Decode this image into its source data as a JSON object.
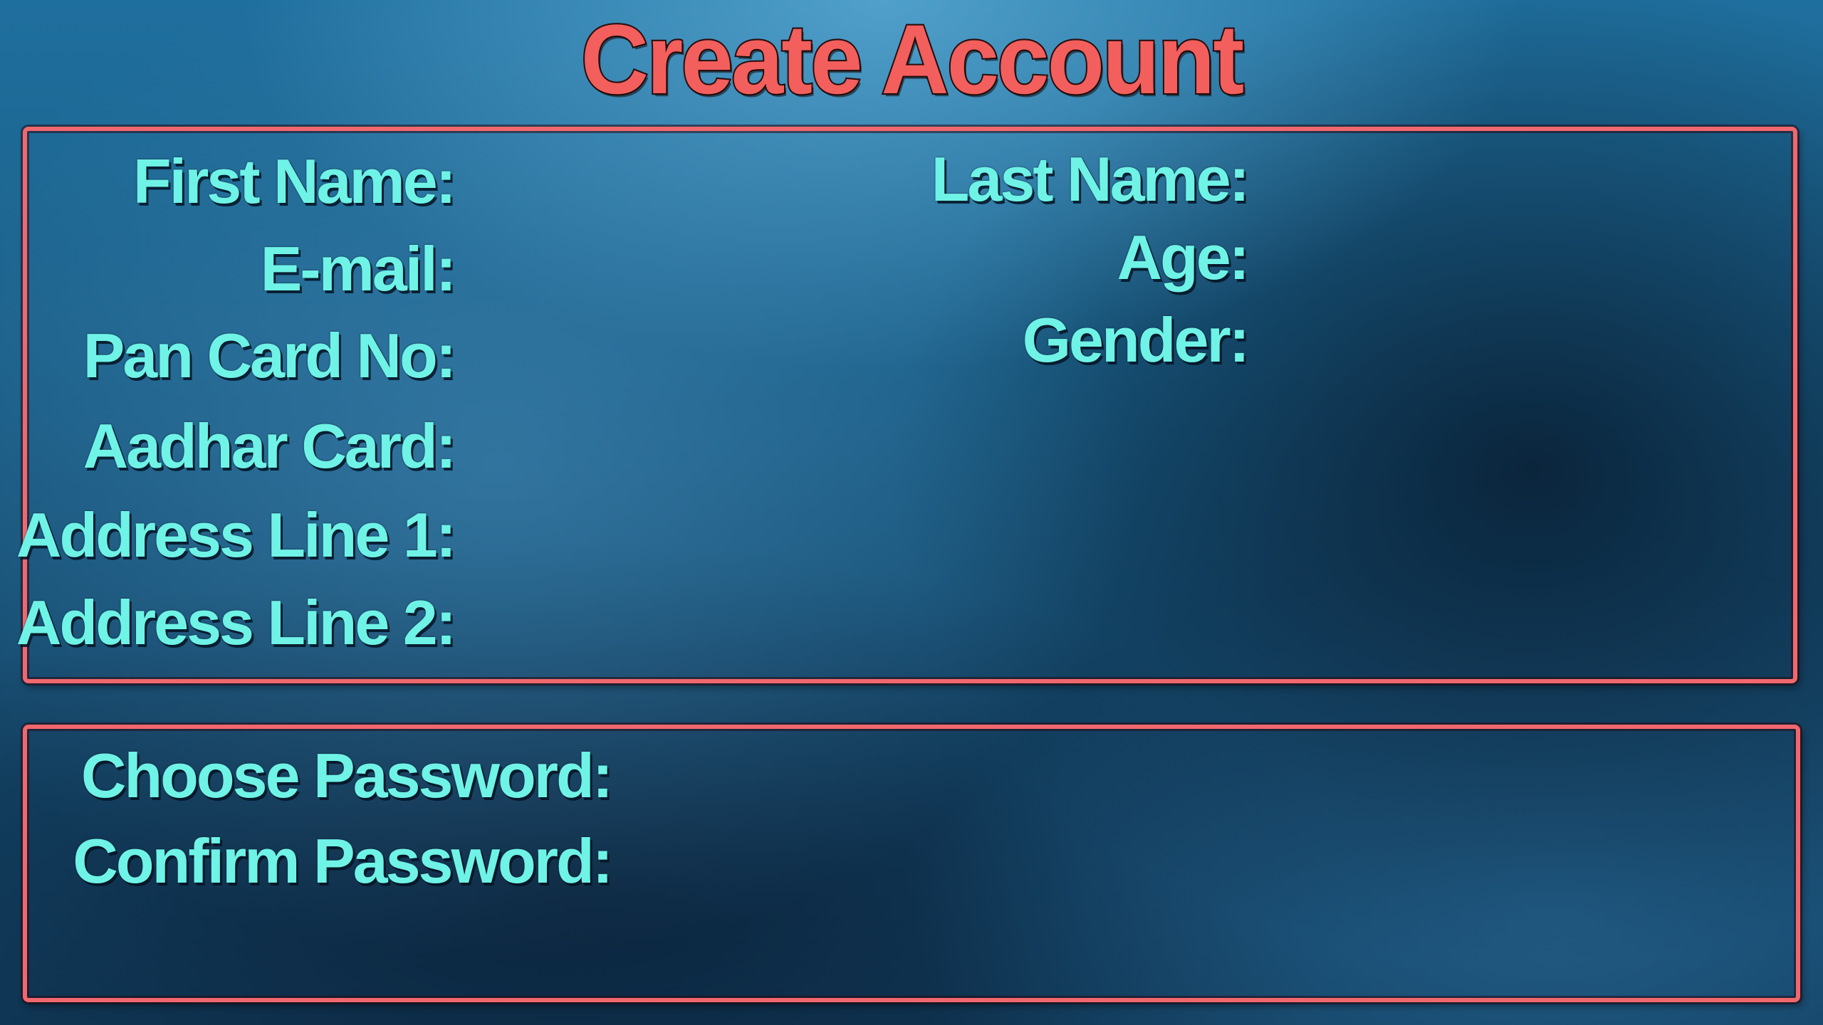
{
  "header": {
    "title": "Create Account"
  },
  "account_form": {
    "left_fields": [
      {
        "label": "First Name:"
      },
      {
        "label": "E-mail:"
      },
      {
        "label": "Pan Card No:"
      },
      {
        "label": "Aadhar Card:"
      },
      {
        "label": "Address Line 1:"
      },
      {
        "label": "Address Line 2:"
      }
    ],
    "right_fields": [
      {
        "label": "Last Name:"
      },
      {
        "label": "Age:"
      },
      {
        "label": "Gender:"
      }
    ]
  },
  "password_form": {
    "fields": [
      {
        "label": "Choose Password:"
      },
      {
        "label": "Confirm Password:"
      }
    ]
  },
  "colors": {
    "title": "#f25f5c",
    "label": "#6ff3e6",
    "panel_border": "#f0686d",
    "background": "#1a5f88"
  }
}
